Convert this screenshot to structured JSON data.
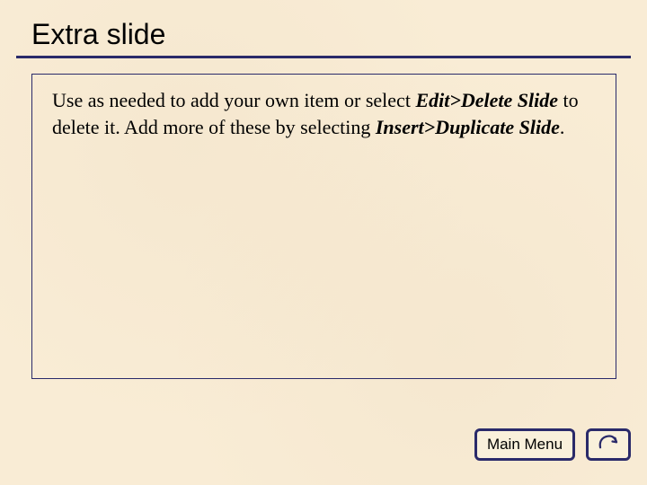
{
  "title": "Extra slide",
  "body": {
    "pre1": "Use as needed to add your own item or select ",
    "em1": "Edit>Delete Slide",
    "mid1": " to delete it. Add more of these by selecting ",
    "em2": "Insert>Duplicate Slide",
    "post": "."
  },
  "buttons": {
    "main_menu": "Main Menu"
  }
}
